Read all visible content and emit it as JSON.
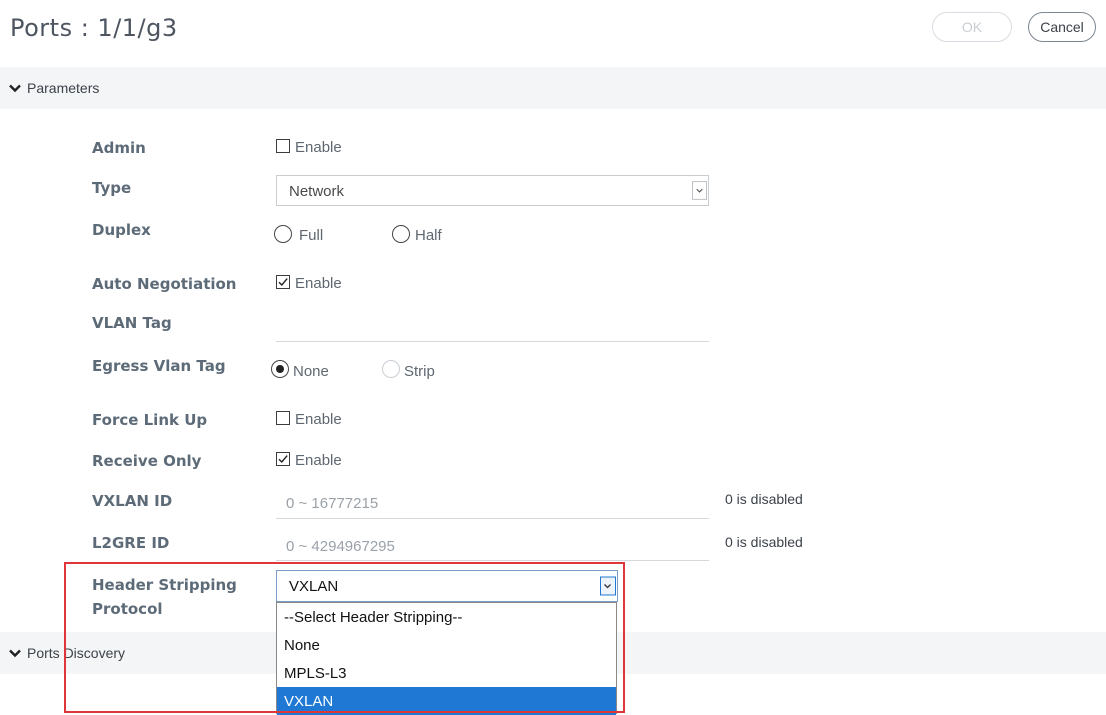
{
  "header": {
    "title": "Ports : 1/1/g3",
    "ok_label": "OK",
    "cancel_label": "Cancel"
  },
  "sections": {
    "parameters": "Parameters",
    "ports_discovery": "Ports Discovery"
  },
  "form": {
    "admin": {
      "label": "Admin",
      "option": "Enable",
      "checked": false
    },
    "type": {
      "label": "Type",
      "value": "Network"
    },
    "duplex": {
      "label": "Duplex",
      "options": [
        "Full",
        "Half"
      ]
    },
    "auto_negotiation": {
      "label": "Auto Negotiation",
      "option": "Enable",
      "checked": true
    },
    "vlan_tag": {
      "label": "VLAN Tag",
      "value": ""
    },
    "egress_vlan_tag": {
      "label": "Egress Vlan Tag",
      "options": [
        "None",
        "Strip"
      ],
      "selected": "None"
    },
    "force_link_up": {
      "label": "Force Link Up",
      "option": "Enable",
      "checked": false
    },
    "receive_only": {
      "label": "Receive Only",
      "option": "Enable",
      "checked": true
    },
    "vxlan_id": {
      "label": "VXLAN ID",
      "placeholder": "0 ~ 16777215",
      "note": "0 is disabled"
    },
    "l2gre_id": {
      "label": "L2GRE ID",
      "placeholder": "0 ~ 4294967295",
      "note": "0 is disabled"
    },
    "header_stripping": {
      "label_line1": "Header Stripping",
      "label_line2": "Protocol",
      "value": "VXLAN",
      "options": [
        "--Select Header Stripping--",
        "None",
        "MPLS-L3",
        "VXLAN"
      ],
      "selected_index": 3
    }
  },
  "colors": {
    "accent_selected": "#1e78d4",
    "highlight_border": "#e0363a"
  }
}
